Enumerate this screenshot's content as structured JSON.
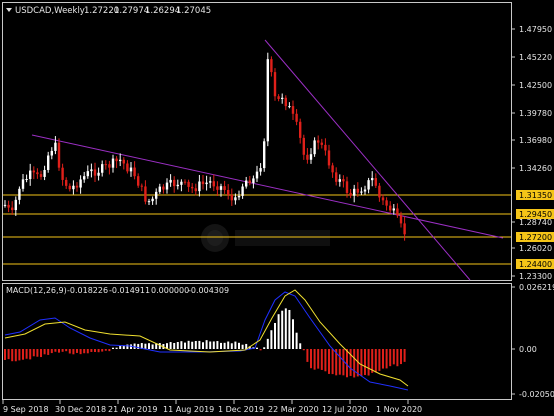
{
  "chart_header": {
    "symbol_label": "USDCAD,Weekly",
    "ohlc": [
      "1.27220",
      "1.27974",
      "1.26294",
      "1.27045"
    ]
  },
  "price_axis": {
    "ticks": [
      "1.47950",
      "1.45220",
      "1.42500",
      "1.39780",
      "1.36980",
      "1.34260",
      "1.28740",
      "1.26020",
      "1.23300"
    ],
    "level_labels": [
      "1.31350",
      "1.29450",
      "1.27200",
      "1.24400"
    ],
    "level_label_color": "#f5c518"
  },
  "macd_panel": {
    "label": "MACD(12,26,9)",
    "values": [
      "-0.018226",
      "-0.014911",
      "0.000000",
      "-0.004309"
    ],
    "ticks": [
      "0.026219",
      "0.00",
      "-0.020501"
    ]
  },
  "time_axis": {
    "labels": [
      "9 Sep 2018",
      "30 Dec 2018",
      "21 Apr 2019",
      "11 Aug 2019",
      "1 Dec 2019",
      "22 Mar 2020",
      "12 Jul 2020",
      "1 Nov 2020"
    ]
  },
  "chart_data": [
    {
      "type": "candlestick",
      "title": "USDCAD,Weekly",
      "y_range": [
        1.233,
        1.493
      ],
      "y_ticks": [
        1.4795,
        1.4522,
        1.425,
        1.3978,
        1.3698,
        1.3426,
        1.2874,
        1.2602,
        1.233
      ],
      "horizontal_levels": [
        1.3135,
        1.2945,
        1.272,
        1.244
      ],
      "trendlines": [
        {
          "from": [
            "Sep 2018",
            1.377
          ],
          "to": [
            "Nov 2020",
            1.275
          ]
        },
        {
          "from": [
            "Mar 2020",
            1.472
          ],
          "to": [
            "Dec 2020",
            1.236
          ]
        }
      ],
      "last_bar": {
        "open": 1.2722,
        "high": 1.27974,
        "low": 1.26294,
        "close": 1.27045
      },
      "colors": {
        "bull": "#ffffff",
        "bear": "#e0201a",
        "levels": "#f5c518",
        "trendline": "#9b2fc4"
      }
    },
    {
      "type": "bar",
      "title": "MACD(12,26,9)",
      "y_range": [
        -0.0205,
        0.0262
      ],
      "y_ticks": [
        0.026219,
        0.0,
        -0.020501
      ],
      "values_text": {
        "macd": -0.018226,
        "signal": -0.014911,
        "extra": 0.0,
        "histogram": -0.004309
      },
      "colors": {
        "macd_line": "#2030ff",
        "signal_line": "#f0e030",
        "hist_pos": "#ffffff",
        "hist_neg": "#e0201a"
      }
    }
  ]
}
